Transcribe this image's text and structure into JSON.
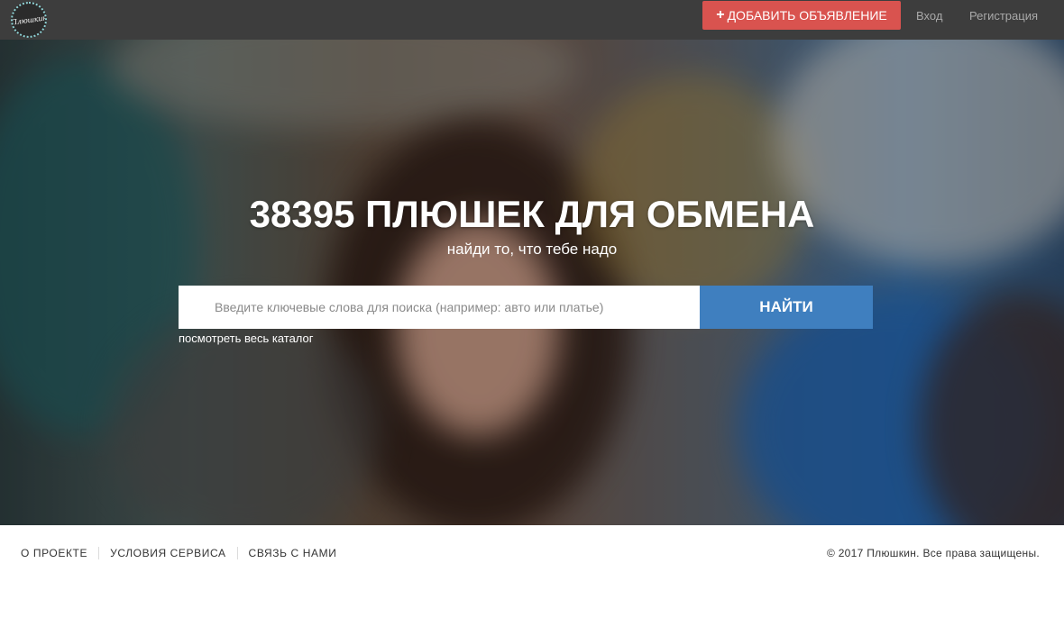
{
  "header": {
    "logo_text": "Плюшкин",
    "add_button": {
      "plus": "+",
      "label": "ДОБАВИТЬ ОБЪЯВЛЕНИЕ"
    },
    "login": "Вход",
    "register": "Регистрация"
  },
  "hero": {
    "title": "38395 ПЛЮШЕК ДЛЯ ОБМЕНА",
    "subtitle": "найди то, что тебе надо",
    "search": {
      "placeholder": "Введите ключевые слова для поиска (например: авто или платье)",
      "value": "",
      "button": "НАЙТИ"
    },
    "catalog_link": "посмотреть весь каталог"
  },
  "footer": {
    "links": [
      "О ПРОЕКТЕ",
      "УСЛОВИЯ СЕРВИСА",
      "СВЯЗЬ С НАМИ"
    ],
    "copyright": "© 2017 Плюшкин. Все права защищены."
  },
  "colors": {
    "topbar": "#3d3d3d",
    "add_button": "#d9534f",
    "search_button": "#3f7fbf",
    "nav_link": "#a9a9a9"
  }
}
